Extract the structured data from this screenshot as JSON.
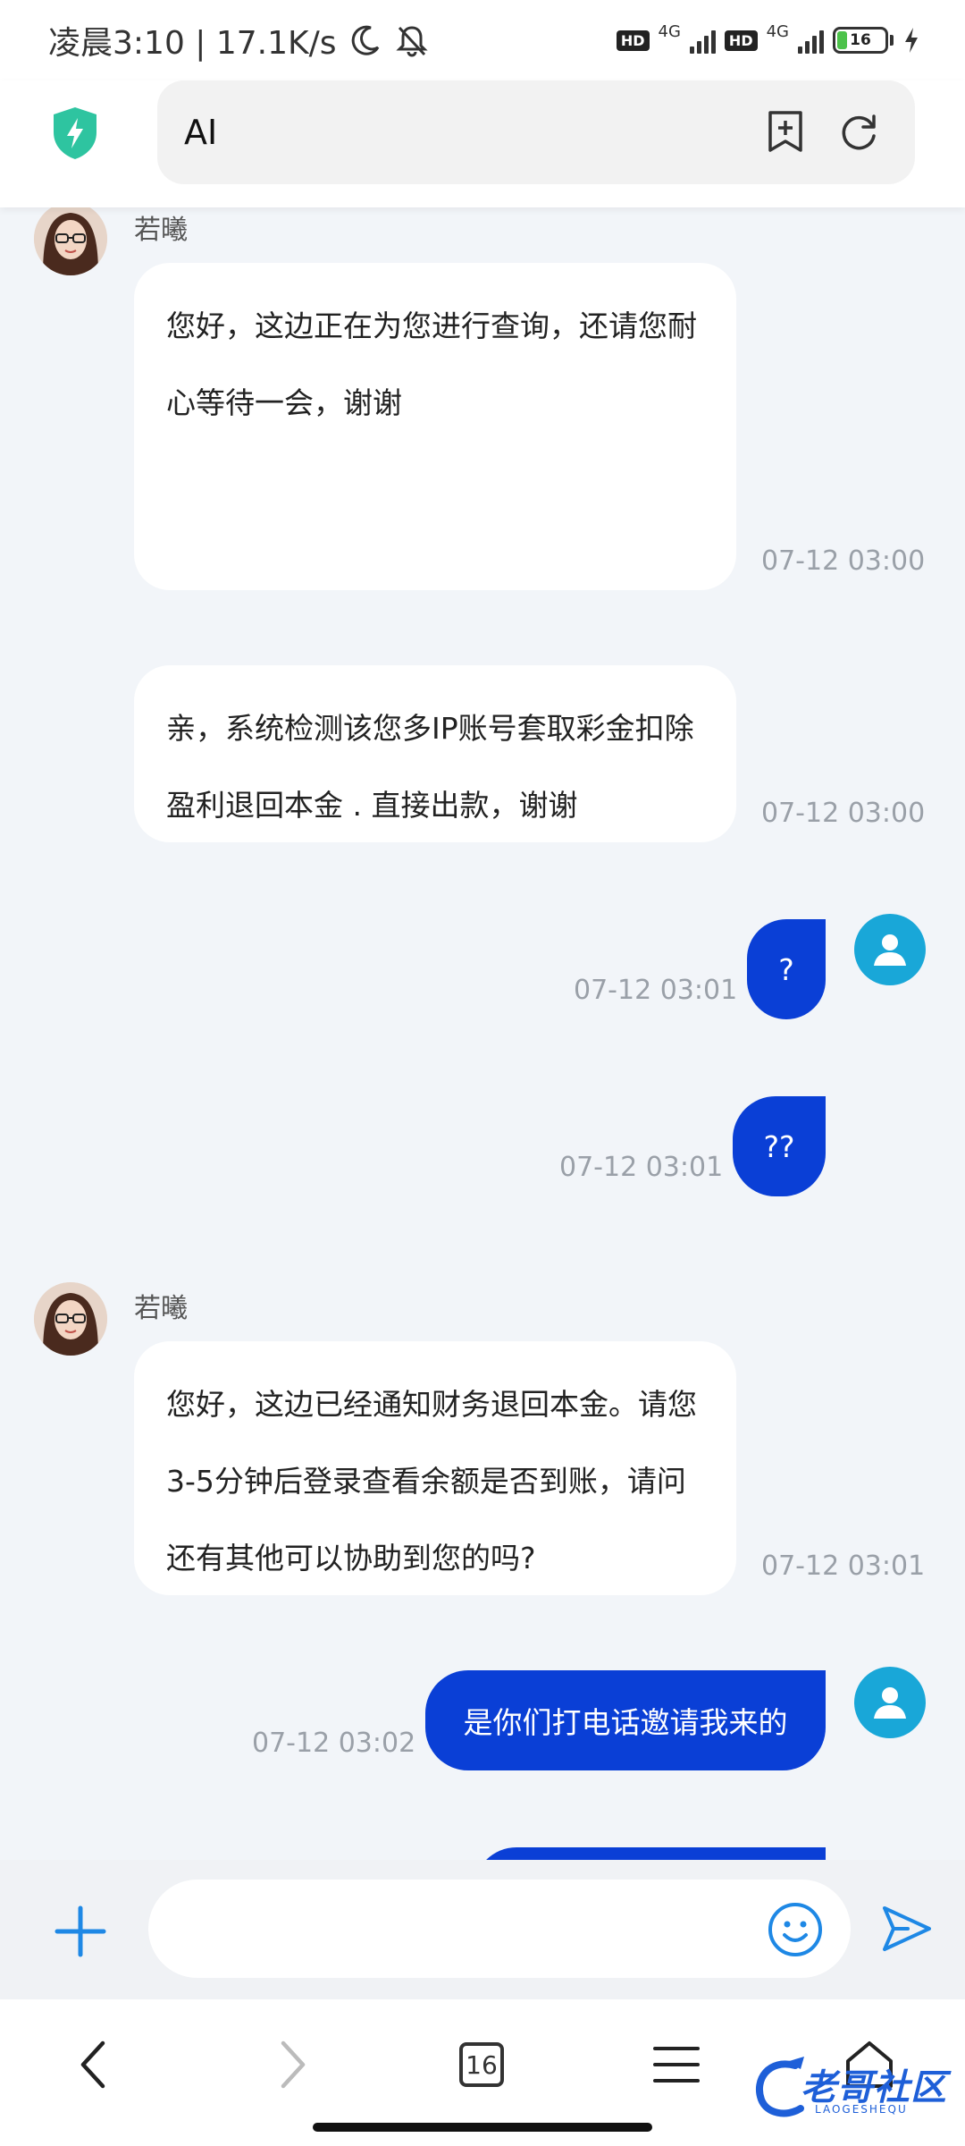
{
  "status_bar": {
    "time_speed": "凌晨3:10 | 17.1K/s",
    "hd_label": "HD",
    "network_type": "4G",
    "battery_level": "16"
  },
  "browser": {
    "url_text": "AI"
  },
  "chat": {
    "agent_name": "若曦",
    "messages": [
      {
        "sender": "agent",
        "text": "您好，这边正在为您进行查询，还请您耐心等待一会，谢谢",
        "time": "07-12 03:00"
      },
      {
        "sender": "agent",
        "text": "亲，系统检测该您多IP账号套取彩金扣除盈利退回本金 . 直接出款，谢谢",
        "time": "07-12 03:00"
      },
      {
        "sender": "user",
        "text": "?",
        "time": "07-12 03:01"
      },
      {
        "sender": "user",
        "text": "??",
        "time": "07-12 03:01"
      },
      {
        "sender": "agent",
        "text": "您好，这边已经通知财务退回本金。请您3-5分钟后登录查看余额是否到账，请问还有其他可以协助到您的吗?",
        "time": "07-12 03:01"
      },
      {
        "sender": "user",
        "text": "是你们打电话邀请我来的",
        "time": "07-12 03:02"
      }
    ]
  },
  "input": {
    "placeholder": ""
  },
  "bottom_nav": {
    "tab_count": "16"
  },
  "watermark": {
    "text": "老哥社区",
    "sub": "LAOGESHEQU"
  },
  "colors": {
    "user_bubble": "#0a3fd6",
    "user_avatar": "#19a7d8",
    "accent_icon": "#1e88e5",
    "shield": "#2ec4a0"
  }
}
